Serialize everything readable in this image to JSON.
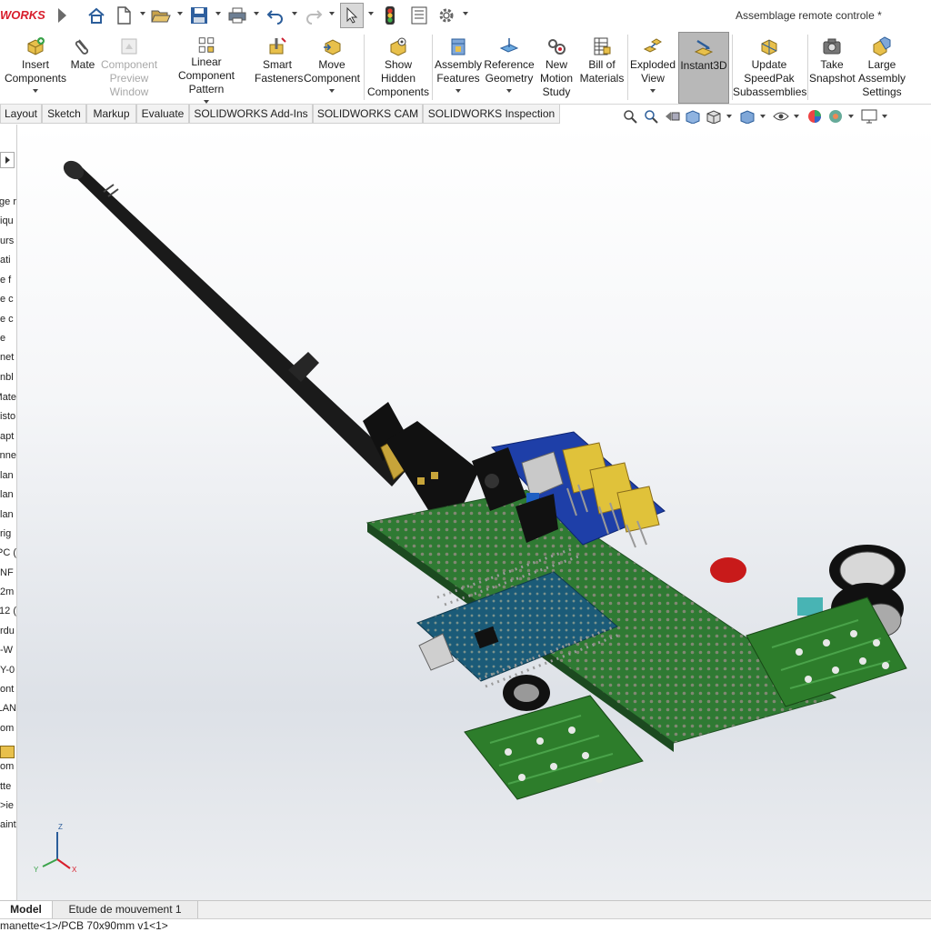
{
  "app": {
    "logo": "WORKS",
    "document_title": "Assemblage remote controle *"
  },
  "quick_toolbar": {
    "icons": [
      "home-icon",
      "new-document-icon",
      "open-icon",
      "save-icon",
      "print-icon",
      "undo-icon",
      "redo-icon",
      "select-pointer-icon",
      "rebuild-traffic-light-icon",
      "file-properties-icon",
      "options-gear-icon"
    ]
  },
  "ribbon": {
    "buttons": [
      {
        "id": "insert-components",
        "label": "Insert Components",
        "icon": "insert-components-icon",
        "enabled": true
      },
      {
        "id": "mate",
        "label": "Mate",
        "icon": "paperclip-mate-icon",
        "enabled": true
      },
      {
        "id": "component-preview-window",
        "label": "Component Preview Window",
        "icon": "preview-window-icon",
        "enabled": false
      },
      {
        "id": "linear-component-pattern",
        "label": "Linear Component Pattern",
        "icon": "linear-pattern-icon",
        "enabled": true
      },
      {
        "id": "smart-fasteners",
        "label": "Smart Fasteners",
        "icon": "smart-fasteners-icon",
        "enabled": true
      },
      {
        "id": "move-component",
        "label": "Move Component",
        "icon": "move-component-icon",
        "enabled": true
      },
      {
        "id": "show-hidden-components",
        "label": "Show Hidden Components",
        "icon": "show-hidden-icon",
        "enabled": true
      },
      {
        "id": "assembly-features",
        "label": "Assembly Features",
        "icon": "assembly-features-icon",
        "enabled": true
      },
      {
        "id": "reference-geometry",
        "label": "Reference Geometry",
        "icon": "reference-geometry-icon",
        "enabled": true
      },
      {
        "id": "new-motion-study",
        "label": "New Motion Study",
        "icon": "motion-study-icon",
        "enabled": true
      },
      {
        "id": "bill-of-materials",
        "label": "Bill of Materials",
        "icon": "bill-of-materials-icon",
        "enabled": true
      },
      {
        "id": "exploded-view",
        "label": "Exploded View",
        "icon": "exploded-view-icon",
        "enabled": true
      },
      {
        "id": "instant3d",
        "label": "Instant3D",
        "icon": "instant3d-icon",
        "enabled": true,
        "active": true
      },
      {
        "id": "update-speedpak",
        "label": "Update SpeedPak Subassemblies",
        "icon": "speedpak-icon",
        "enabled": true
      },
      {
        "id": "take-snapshot",
        "label": "Take Snapshot",
        "icon": "camera-icon",
        "enabled": true
      },
      {
        "id": "large-assembly-settings",
        "label": "Large Assembly Settings",
        "icon": "large-assembly-icon",
        "enabled": true
      }
    ]
  },
  "command_tabs": [
    "Layout",
    "Sketch",
    "Markup",
    "Evaluate",
    "SOLIDWORKS Add-Ins",
    "SOLIDWORKS CAM",
    "SOLIDWORKS Inspection"
  ],
  "heads_up_toolbar": {
    "icons": [
      "zoom-to-fit-icon",
      "zoom-to-area-icon",
      "previous-view-icon",
      "section-view-icon",
      "view-orientation-icon",
      "display-style-icon",
      "hide-show-items-icon",
      "edit-appearance-icon",
      "apply-scene-icon",
      "view-settings-icon"
    ]
  },
  "feature_tree": {
    "items": [
      "ge r",
      "iqu",
      "urs",
      "ati",
      "e f",
      "e c",
      "e c",
      "e",
      "net",
      "nbl",
      "Mate",
      "isto",
      "apt",
      "nne",
      "lan",
      "lan",
      "lan",
      "rig",
      ") PC",
      "NF",
      "2m",
      ") 12",
      "rdu",
      "W-",
      "Y-0",
      "ont",
      "LAN",
      "om",
      "",
      "om",
      "tte",
      "ie<",
      "aint"
    ]
  },
  "viewport": {
    "triad": {
      "x": "X",
      "y": "Y",
      "z": "Z"
    }
  },
  "bottom_tabs": [
    "Model",
    "Etude de mouvement 1"
  ],
  "status": {
    "text": "manette<1>/PCB 70x90mm v1<1>"
  },
  "colors": {
    "logo_red": "#d81e2c",
    "active_button": "#b8b8b8",
    "pcb_green": "#2f7a33",
    "board_blue": "#1e3fa8",
    "antenna_black": "#1a1a1a"
  }
}
